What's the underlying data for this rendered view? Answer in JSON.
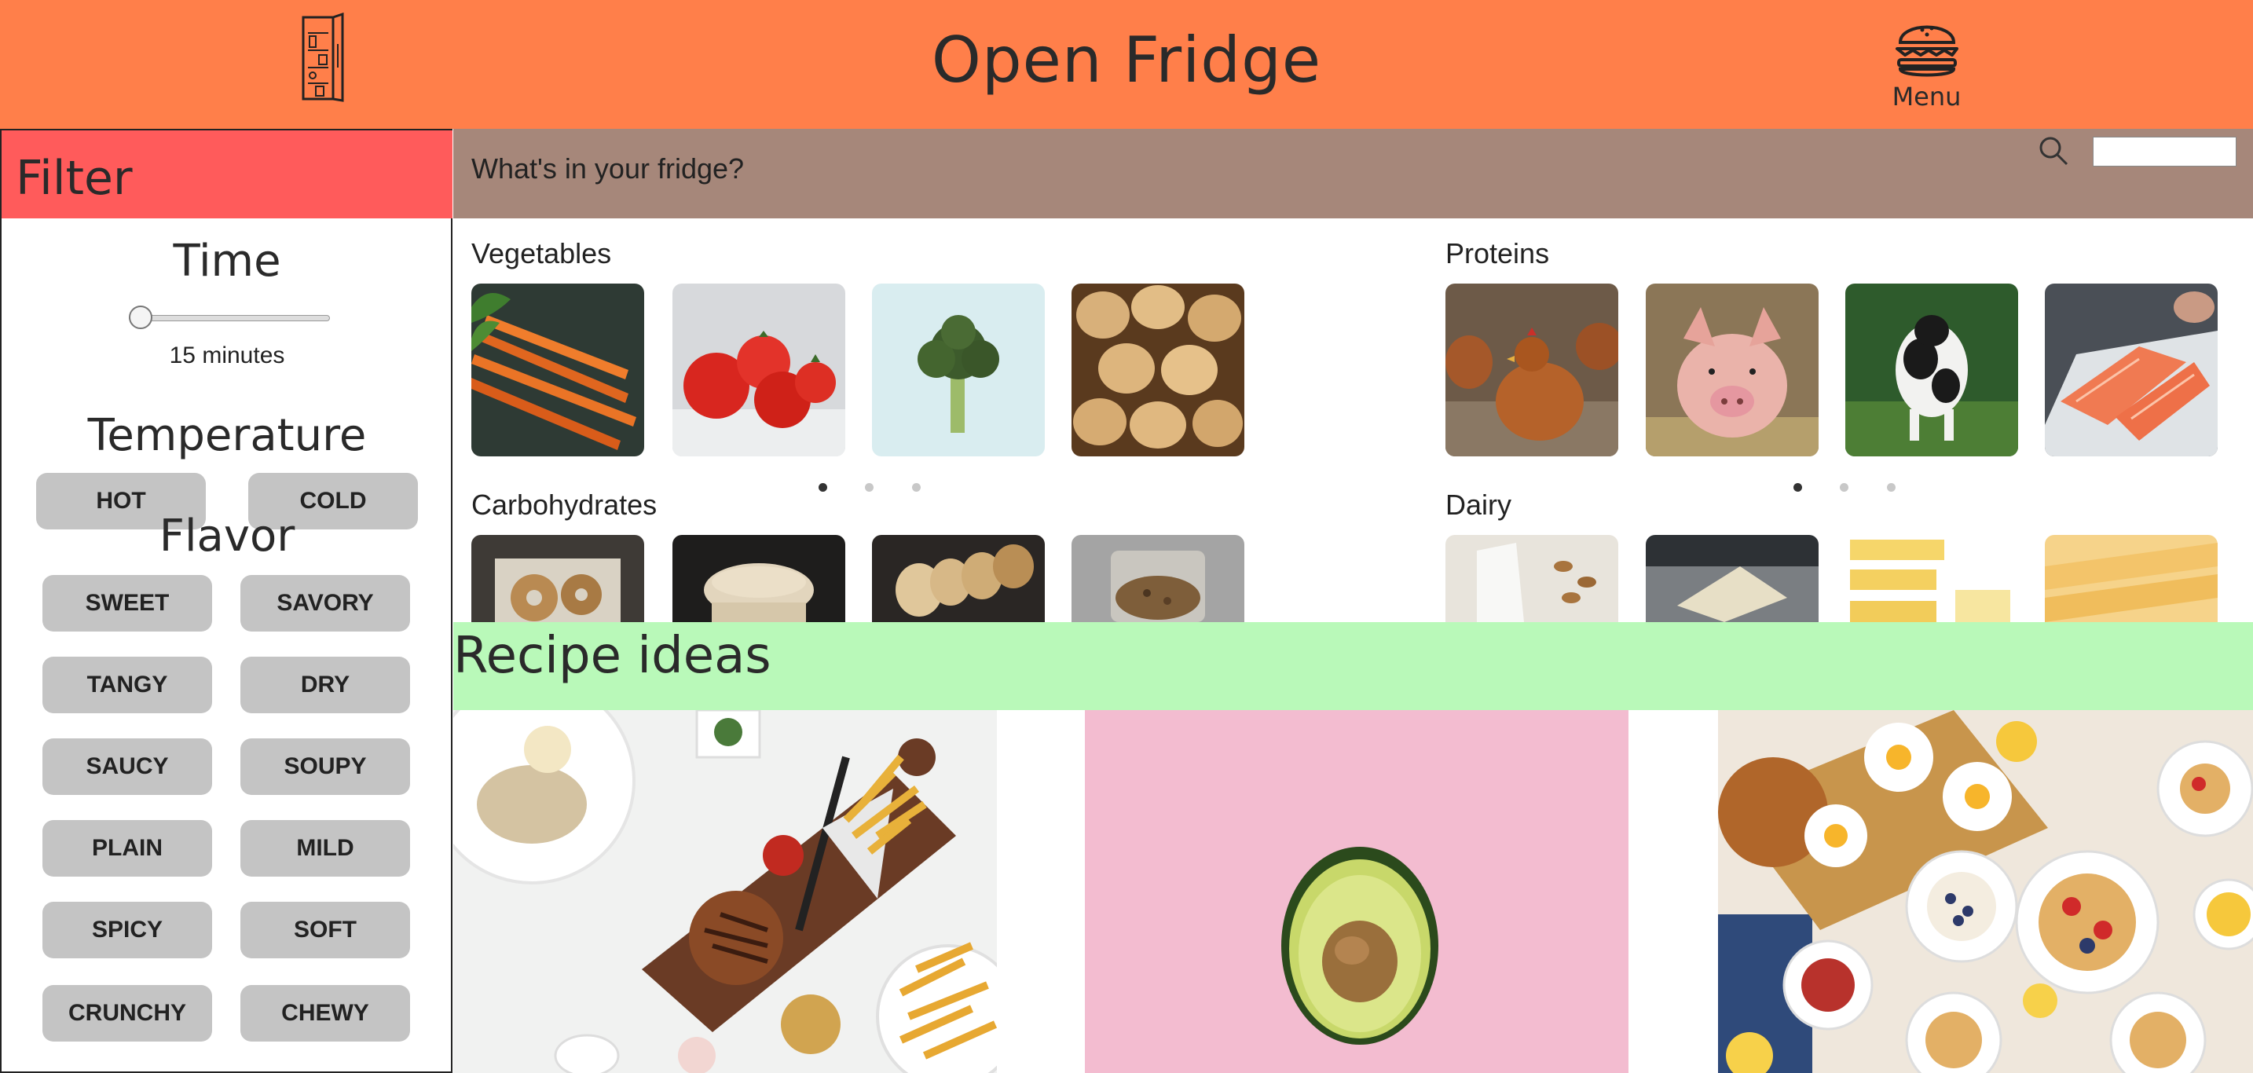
{
  "header": {
    "title": "Open Fridge",
    "logo_icon": "fridge-icon",
    "menu_icon": "burger-icon",
    "menu_label": "Menu",
    "background": "#ff7f4a"
  },
  "filter": {
    "title": "Filter",
    "header_color": "#ff5b5b",
    "time": {
      "title": "Time",
      "value_label": "15 minutes",
      "slider_fraction": 0.0
    },
    "temperature": {
      "title": "Temperature",
      "options": [
        "HOT",
        "COLD"
      ]
    },
    "flavor": {
      "title": "Flavor",
      "options": [
        "SWEET",
        "SAVORY",
        "TANGY",
        "DRY",
        "SAUCY",
        "SOUPY",
        "PLAIN",
        "MILD",
        "SPICY",
        "SOFT",
        "CRUNCHY",
        "CHEWY"
      ]
    }
  },
  "search": {
    "prompt": "What's in your fridge?",
    "placeholder": "",
    "icon": "search-icon",
    "background": "#a6877a"
  },
  "categories": [
    {
      "title": "Vegetables",
      "items": [
        "carrots",
        "tomatoes",
        "broccoli",
        "onions"
      ],
      "carousel_pages": 3,
      "active_page": 1
    },
    {
      "title": "Proteins",
      "items": [
        "chicken",
        "pig",
        "cow",
        "salmon"
      ],
      "carousel_pages": 3,
      "active_page": 1
    },
    {
      "title": "Carbohydrates",
      "items": [
        "bagels",
        "bread rolls",
        "baguette",
        "granola"
      ]
    },
    {
      "title": "Dairy",
      "items": [
        "milk",
        "cheese wedge",
        "butter",
        "cheese slices"
      ]
    }
  ],
  "recipes": {
    "title": "Recipe ideas",
    "band_color": "#b9f9b9",
    "cards": [
      "burger and fries",
      "avocado",
      "breakfast spread"
    ]
  }
}
